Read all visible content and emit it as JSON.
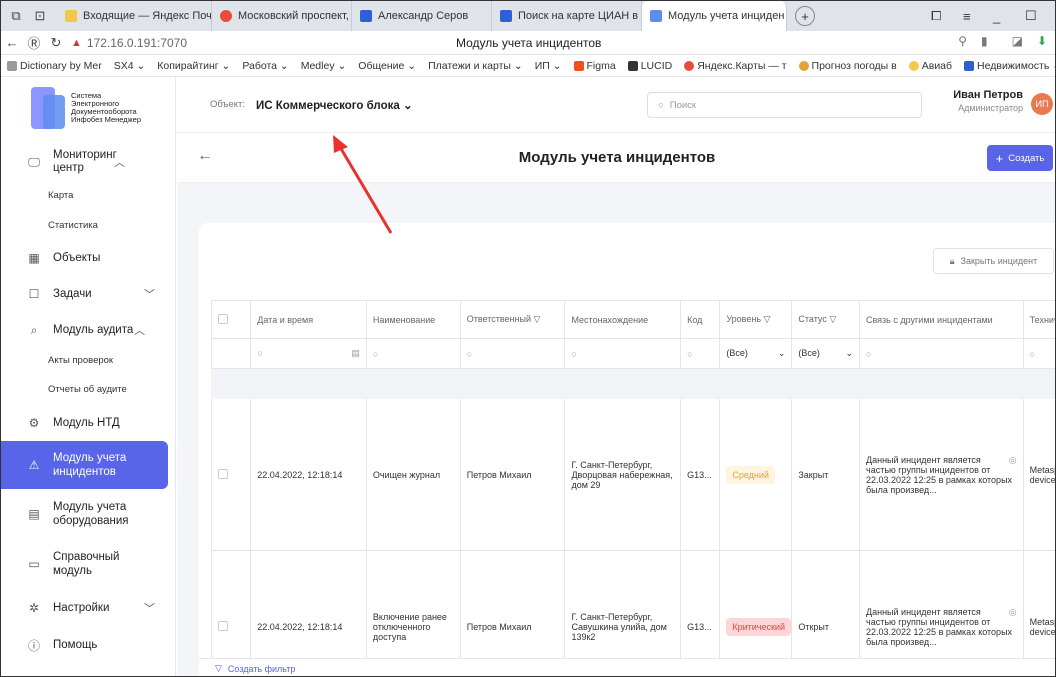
{
  "browser": {
    "tabs": [
      {
        "label": "Входящие — Яндекс Почт",
        "color": "#f2c94c"
      },
      {
        "label": "Московский проспект, 18",
        "color": "#e74c3c"
      },
      {
        "label": "Александр Серов",
        "color": "#2d5fd6"
      },
      {
        "label": "Поиск на карте ЦИАН в Л",
        "color": "#2d5fd6"
      },
      {
        "label": "Модуль учета инциден ×",
        "color": "#5b8def"
      }
    ],
    "url": "172.16.0.191:7070",
    "page_title": "Модуль учета инцидентов",
    "bookmarks": [
      "Dictionary by Mer",
      "SX4 ⌄",
      "Копирайтинг ⌄",
      "Работа ⌄",
      "Medley ⌄",
      "Общение ⌄",
      "Платежи и карты ⌄",
      "ИП ⌄",
      "Figma",
      "LUCID",
      "Яндекс.Карты — т",
      "Прогноз погоды в",
      "Авиаб",
      "Недвижимость ⌄"
    ]
  },
  "logo": {
    "line1": "Система",
    "line2": "Электронного",
    "line3": "Документооборота",
    "line4": "Инфобез Менеджер"
  },
  "sidebar": {
    "monitoring": "Мониторинг центр",
    "map": "Карта",
    "stats": "Статистика",
    "objects": "Объекты",
    "tasks": "Задачи",
    "audit": "Модуль аудита",
    "audit_acts": "Акты проверок",
    "audit_reports": "Отчеты об аудите",
    "ntd": "Модуль НТД",
    "incidents": "Модуль учета инцидентов",
    "equipment": "Модуль учета оборудования",
    "reference": "Справочный модуль",
    "settings": "Настройки",
    "help": "Помощь"
  },
  "topbar": {
    "object_label": "Объект:",
    "object_value": "ИС Коммерческого блока ⌄",
    "search_placeholder": "Поиск",
    "user_name": "Иван Петров",
    "user_role": "Администратор",
    "avatar": "ИП"
  },
  "page": {
    "title": "Модуль учета инцидентов",
    "create": "Создать",
    "close_incident": "Закрыть инцидент",
    "create_filter": "Создать фильтр"
  },
  "table": {
    "headers": [
      "Дата и время",
      "Наименование",
      "Ответственный",
      "Местонахождение",
      "Код",
      "Уровень",
      "Статус",
      "Связь с другими инцидентами",
      "Технические пар"
    ],
    "filter_all": "(Все)",
    "rows": [
      {
        "date": "22.04.2022, 12:18:14",
        "name": "Очищен журнал",
        "owner": "Петров Михаил",
        "location": "Г. Санкт-Петербург, Дворцовая набережная, дом 29",
        "code": "G13...",
        "level": "Средний",
        "status": "Закрыт",
        "link": "Данный инцидент является частью группы инцидентов от 22.03.2022 12:25 в рамках которых была произвед...",
        "tech": "Metasploit Frame deviceslogs"
      },
      {
        "date": "22.04.2022, 12:18:14",
        "name": "Включение ранее отключенного доступа",
        "owner": "Петров Михаил",
        "location": "Г. Санкт-Петербург, Савушкина улийа, дом 139к2",
        "code": "G13...",
        "level": "Критический",
        "status": "Открыт",
        "link": "Данный инцидент является частью группы инцидентов от 22.03.2022 12:25 в рамках которых была произвед...",
        "tech": "Metasploit Frame deviceslogs"
      }
    ]
  },
  "colors": {
    "accent": "#5865e8",
    "arrow": "#e8322b"
  }
}
